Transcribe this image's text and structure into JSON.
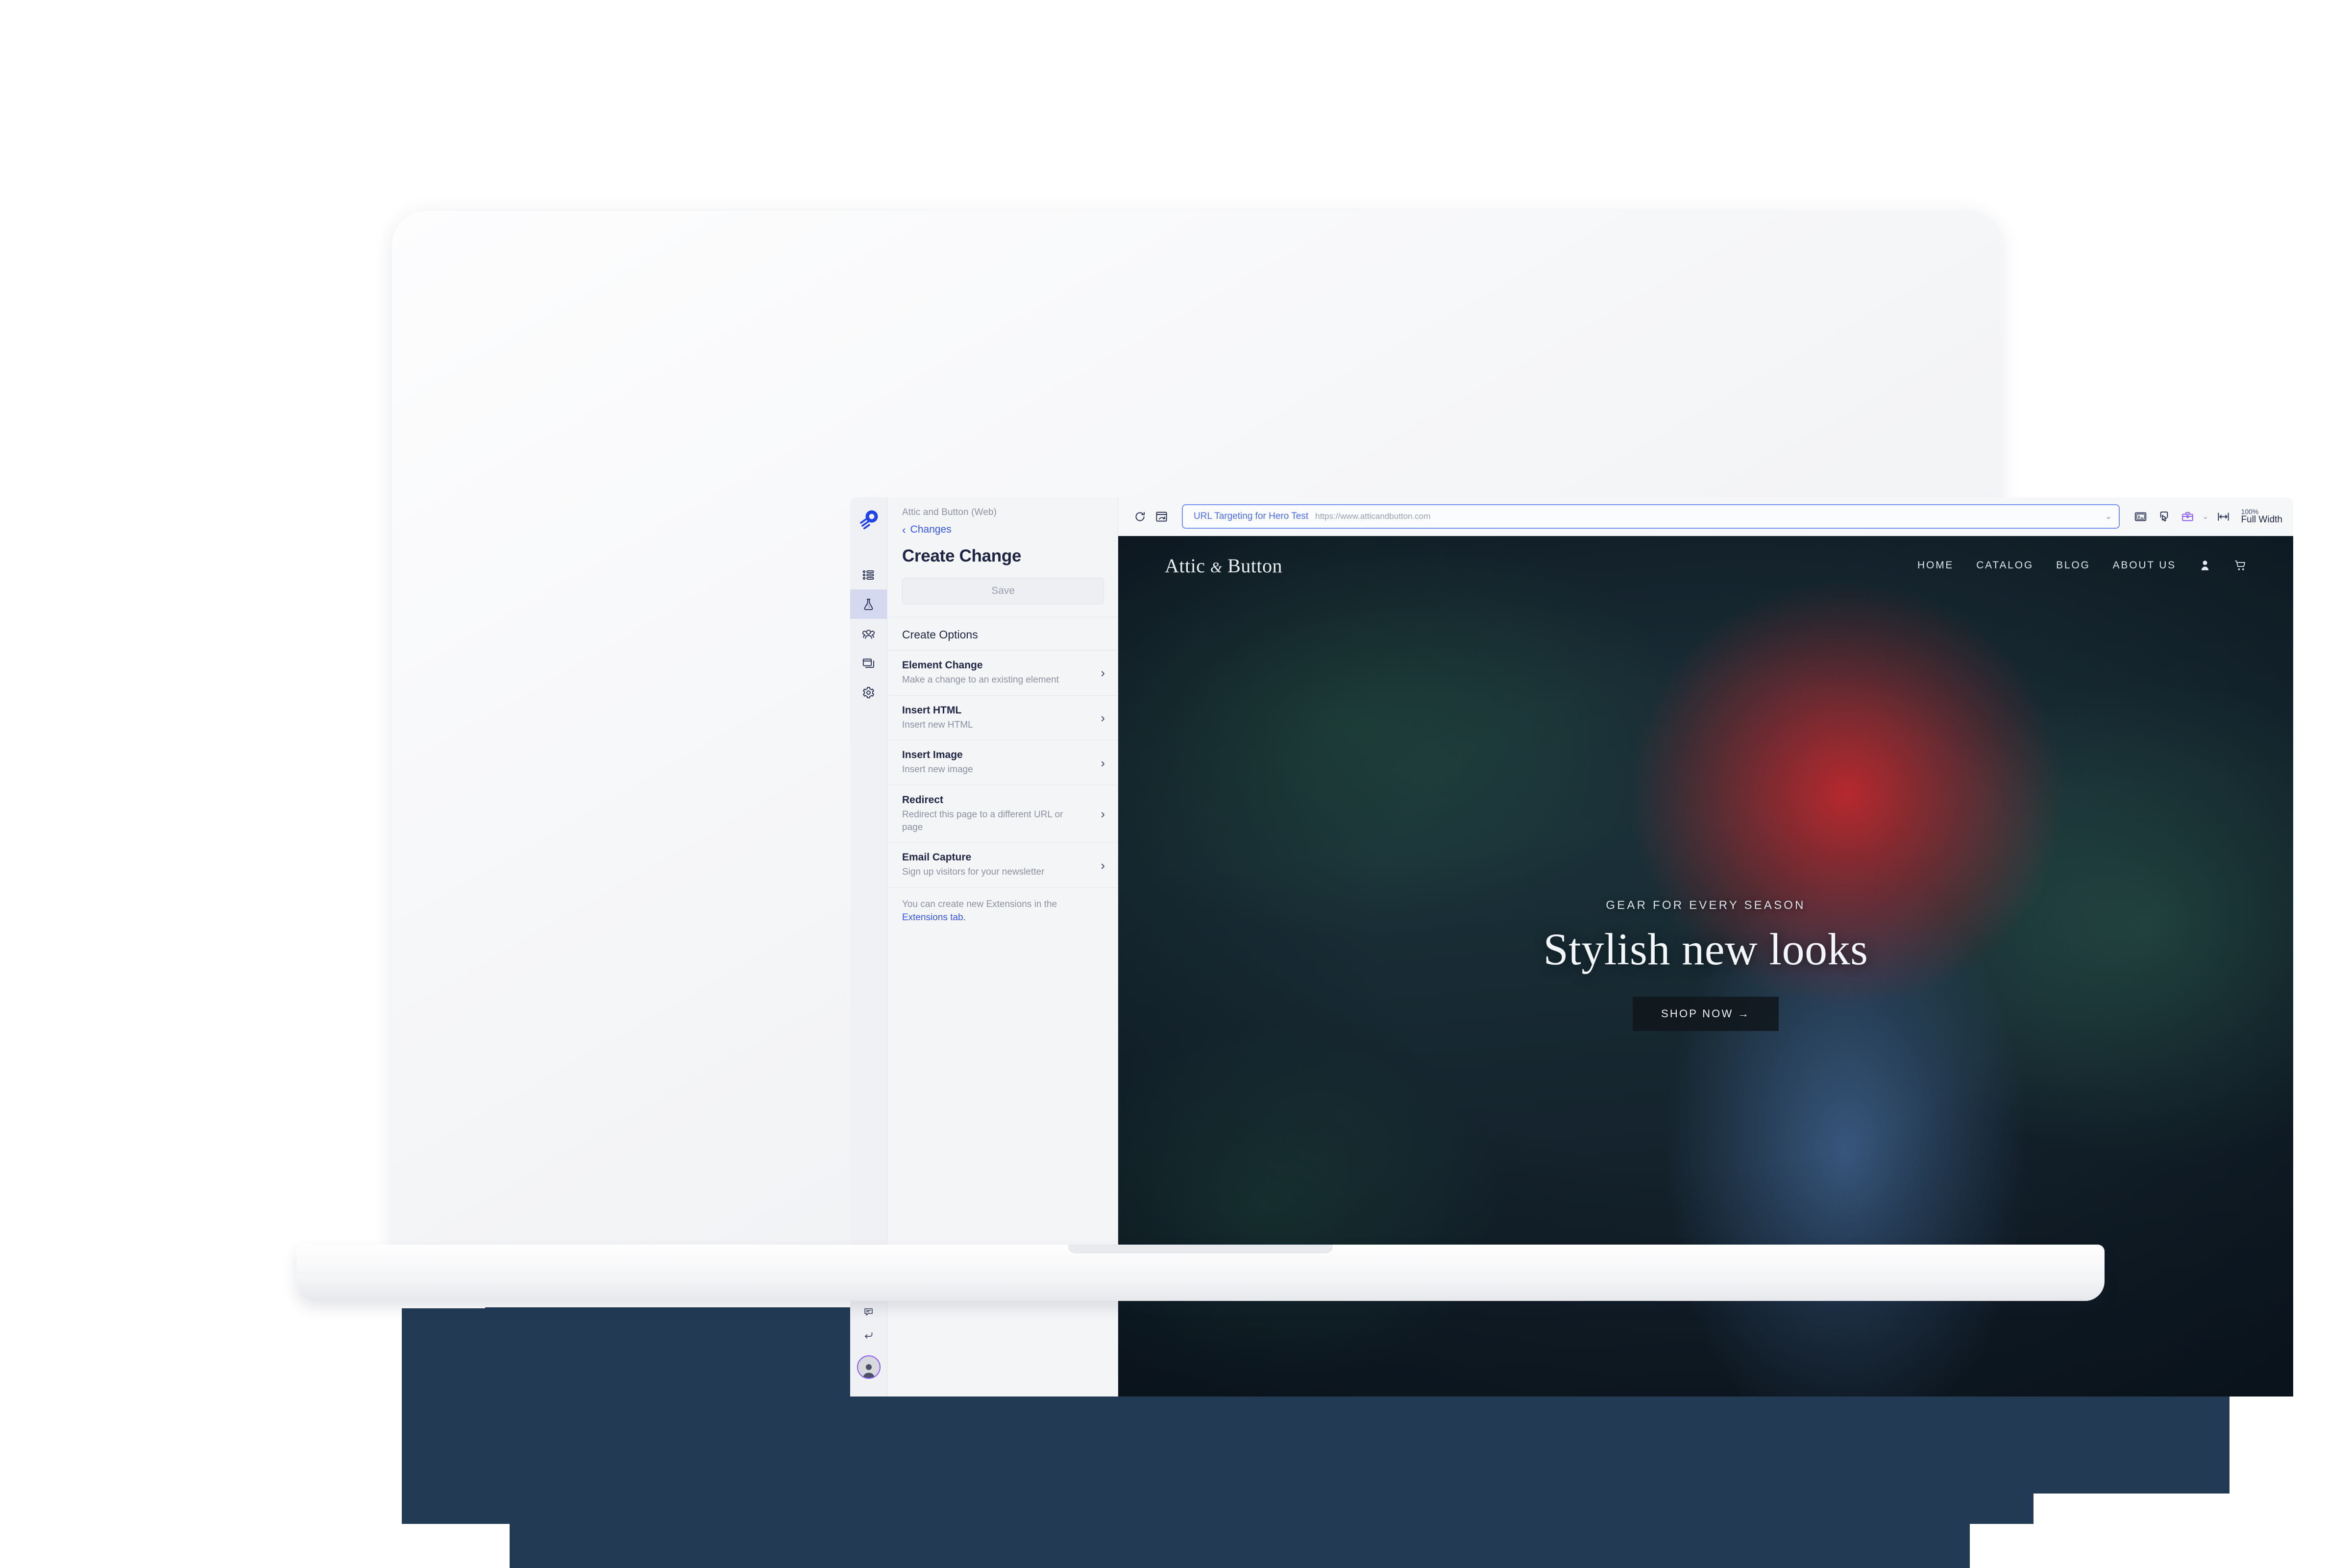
{
  "app": {
    "project_name": "Attic and Button (Web)",
    "back_label": "Changes",
    "page_title": "Create Change",
    "save_label": "Save",
    "section_label": "Create Options",
    "extensions_note": "You can create new Extensions in the",
    "extensions_link": "Extensions tab.",
    "accent_blue": "#3355e8",
    "rail_active_bg": "#d5d9ef",
    "avatar_ring": "#8b5cf6"
  },
  "rail": {
    "logo_name": "optimizely-rocket-logo",
    "items": [
      {
        "name": "sidebar-item-list",
        "icon": "list-icon",
        "active": false
      },
      {
        "name": "sidebar-item-experiments",
        "icon": "flask-icon",
        "active": true
      },
      {
        "name": "sidebar-item-audiences",
        "icon": "audience-icon",
        "active": false
      },
      {
        "name": "sidebar-item-pages",
        "icon": "windows-icon",
        "active": false
      },
      {
        "name": "sidebar-item-settings",
        "icon": "gear-icon",
        "active": false
      }
    ],
    "bottom_items": [
      {
        "name": "sidebar-item-network",
        "icon": "network-icon"
      },
      {
        "name": "sidebar-item-help",
        "icon": "question-circle-icon"
      },
      {
        "name": "sidebar-item-feedback",
        "icon": "comment-icon"
      },
      {
        "name": "sidebar-item-exit",
        "icon": "arrow-return-icon"
      }
    ],
    "avatar_name": "user-avatar"
  },
  "create_options": [
    {
      "title": "Element Change",
      "desc": "Make a change to an existing element"
    },
    {
      "title": "Insert HTML",
      "desc": "Insert new HTML"
    },
    {
      "title": "Insert Image",
      "desc": "Insert new image"
    },
    {
      "title": "Redirect",
      "desc": "Redirect this page to a different URL or page"
    },
    {
      "title": "Email Capture",
      "desc": "Sign up visitors for your newsletter"
    }
  ],
  "toolbar": {
    "reload_icon": "reload-icon",
    "reload_frame_icon": "reload-frame-icon",
    "url_label": "URL Targeting for Hero Test",
    "url_value": "https://www.atticandbutton.com",
    "url_caret": "⌄",
    "console_icon": "console-icon",
    "interactive_icon": "pointer-select-icon",
    "extensions_icon": "toolbox-icon",
    "extensions_caret": "⌄",
    "width_icon": "full-width-icon",
    "zoom_percent": "100%",
    "zoom_mode": "Full Width"
  },
  "site": {
    "brand_left": "Attic",
    "brand_amp": "&",
    "brand_right": "Button",
    "nav": [
      "HOME",
      "CATALOG",
      "BLOG",
      "ABOUT US"
    ],
    "account_icon": "user-icon",
    "cart_icon": "cart-icon",
    "hero_kicker": "GEAR FOR EVERY SEASON",
    "hero_title": "Stylish new looks",
    "hero_cta": "SHOP NOW →"
  },
  "decor": {
    "navy": "#223a54"
  }
}
